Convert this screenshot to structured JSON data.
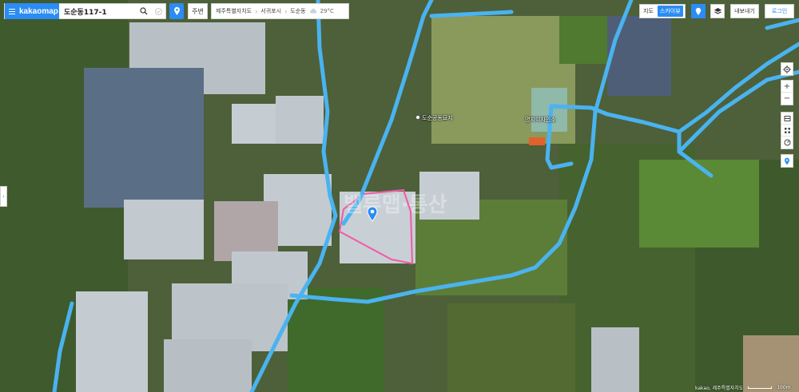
{
  "search": {
    "brand": "kakaomap",
    "query": "도순동117-1"
  },
  "toolbar": {
    "nearby_label": "주변"
  },
  "breadcrumb": {
    "province": "제주특별자치도",
    "city": "서귀포시",
    "dong": "도순동",
    "temperature": "29°C"
  },
  "view": {
    "map_label": "지도",
    "skyview_label": "스카이뷰",
    "active": "스카이뷰"
  },
  "actions": {
    "share_label": "내보내기",
    "login_label": "로그인"
  },
  "map_labels": {
    "community_center": "도순공동묘지",
    "facility": "명지디자인소"
  },
  "watermark": "밸류맵·통산",
  "footer": {
    "copyright": "kakao, 제주특별자치도",
    "scale": "100m"
  },
  "colors": {
    "accent": "#2b8cf4",
    "road": "#4ab3f0",
    "parcel": "#f05aa6"
  }
}
